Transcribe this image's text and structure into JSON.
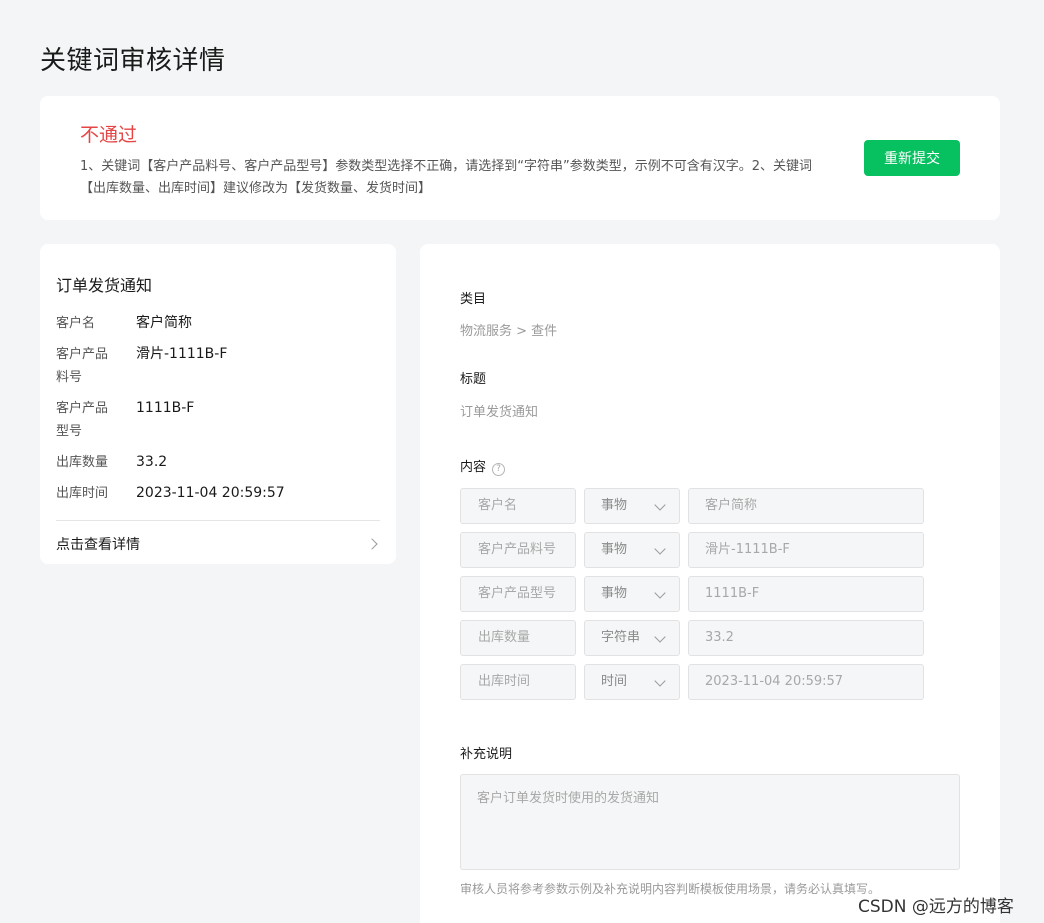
{
  "page": {
    "title": "关键词审核详情"
  },
  "status": {
    "title": "不通过",
    "reason": "1、关键词【客户产品料号、客户产品型号】参数类型选择不正确，请选择到“字符串”参数类型，示例不可含有汉字。2、关键词【出库数量、出库时间】建议修改为【发货数量、发货时间】",
    "resubmit_label": "重新提交",
    "colors": {
      "reject": "#e54545",
      "accent": "#07c160"
    }
  },
  "preview": {
    "title": "订单发货通知",
    "fields": [
      {
        "label": "客户名",
        "value": "客户简称"
      },
      {
        "label": "客户产品料号",
        "value": "滑片-1111B-F"
      },
      {
        "label": "客户产品型号",
        "value": "1111B-F"
      },
      {
        "label": "出库数量",
        "value": "33.2"
      },
      {
        "label": "出库时间",
        "value": "2023-11-04 20:59:57"
      }
    ],
    "link_label": "点击查看详情"
  },
  "detail": {
    "category_label": "类目",
    "category_value": "物流服务 > 查件",
    "title_label": "标题",
    "title_value": "订单发货通知",
    "content_label": "内容",
    "params": [
      {
        "name": "客户名",
        "type": "事物",
        "example": "客户简称"
      },
      {
        "name": "客户产品料号",
        "type": "事物",
        "example": "滑片-1111B-F"
      },
      {
        "name": "客户产品型号",
        "type": "事物",
        "example": "1111B-F"
      },
      {
        "name": "出库数量",
        "type": "字符串",
        "example": "33.2"
      },
      {
        "name": "出库时间",
        "type": "时间",
        "example": "2023-11-04 20:59:57"
      }
    ],
    "note_label": "补充说明",
    "note_value": "客户订单发货时使用的发货通知",
    "note_hint": "审核人员将参考参数示例及补充说明内容判断模板使用场景，请务必认真填写。"
  },
  "watermark": "CSDN @远方的博客"
}
